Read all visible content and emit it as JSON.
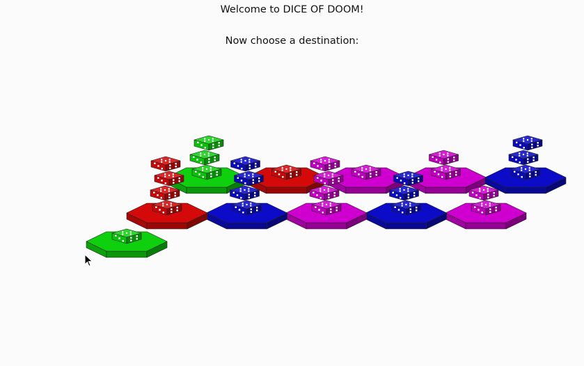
{
  "header": {
    "title": "Welcome to DICE OF DOOM!",
    "prompt": "Now choose a destination:"
  },
  "colors": {
    "green": "#0fd00f",
    "red": "#d40a0a",
    "blue": "#0b0bc8",
    "magenta": "#cf00cf"
  },
  "board": {
    "back_row": [
      {
        "owner": "green",
        "dice": 3
      },
      {
        "owner": "red",
        "dice": 1
      },
      {
        "owner": "magenta",
        "dice": 1
      },
      {
        "owner": "magenta",
        "dice": 2
      },
      {
        "owner": "blue",
        "dice": 3
      }
    ],
    "front_row": [
      {
        "owner": "green",
        "dice": 1
      },
      {
        "owner": "red",
        "dice": 4
      },
      {
        "owner": "blue",
        "dice": 4
      },
      {
        "owner": "magenta",
        "dice": 4
      },
      {
        "owner": "blue",
        "dice": 3
      },
      {
        "owner": "magenta",
        "dice": 2
      }
    ]
  }
}
